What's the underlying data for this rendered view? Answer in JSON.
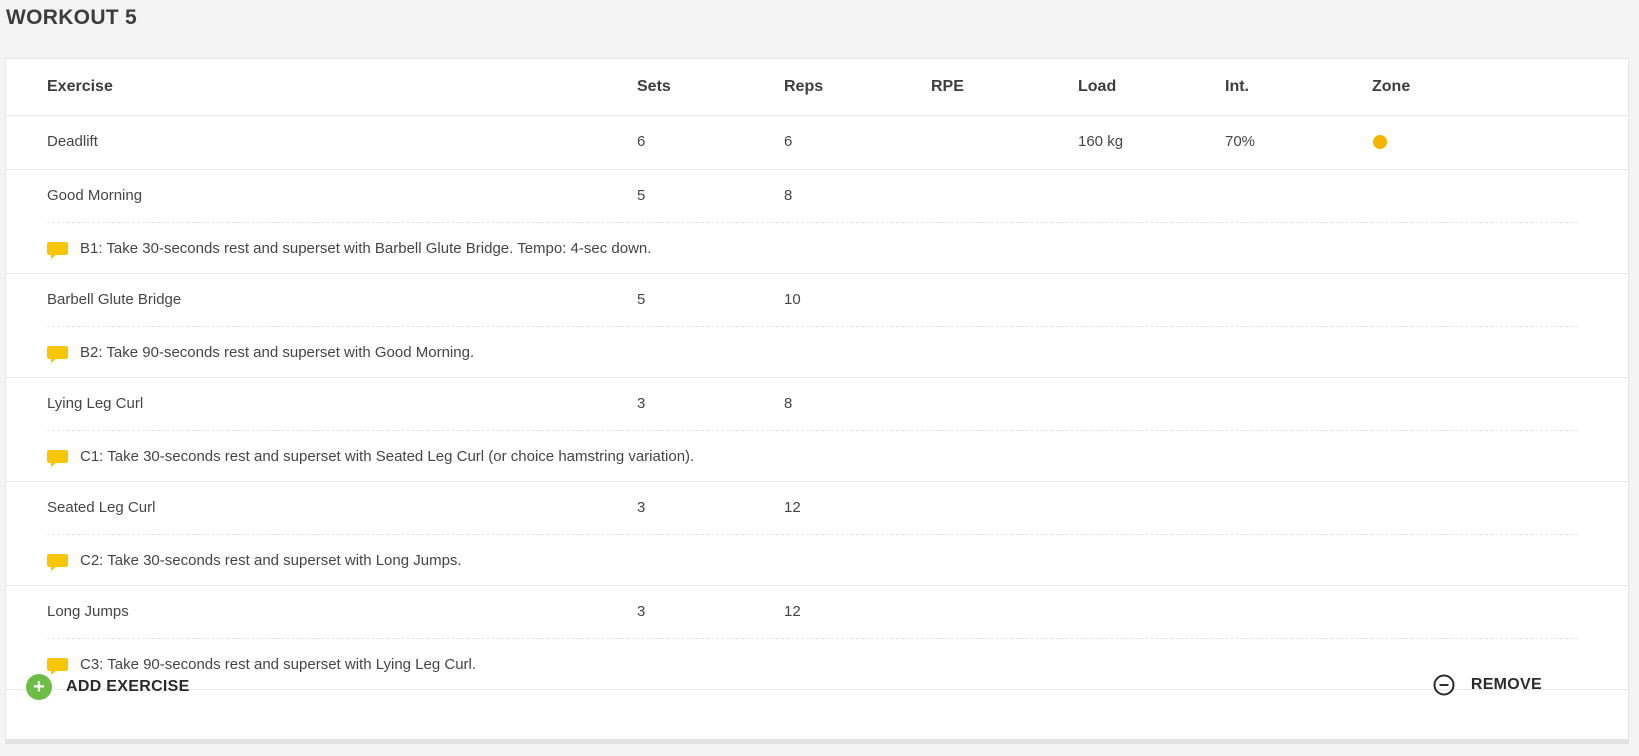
{
  "workout": {
    "title": "WORKOUT 5"
  },
  "colors": {
    "zone_dot": "#f5b400",
    "comment_icon": "#f7c600",
    "add_icon": "#6cbd45"
  },
  "table": {
    "headers": {
      "exercise": "Exercise",
      "sets": "Sets",
      "reps": "Reps",
      "rpe": "RPE",
      "load": "Load",
      "intensity": "Int.",
      "zone": "Zone"
    },
    "rows": [
      {
        "exercise": "Deadlift",
        "sets": "6",
        "reps": "6",
        "rpe": "",
        "load": "160 kg",
        "intensity": "70%",
        "zone_icon": "zone-dot"
      },
      {
        "exercise": "Good Morning",
        "sets": "5",
        "reps": "8",
        "note": "B1: Take 30-seconds rest and superset with Barbell Glute Bridge. Tempo: 4-sec down.",
        "note_icon": "comment-icon"
      },
      {
        "exercise": "Barbell Glute Bridge",
        "sets": "5",
        "reps": "10",
        "note": "B2: Take 90-seconds rest and superset with Good Morning.",
        "note_icon": "comment-icon"
      },
      {
        "exercise": "Lying Leg Curl",
        "sets": "3",
        "reps": "8",
        "note": "C1: Take 30-seconds rest and superset with Seated Leg Curl (or choice hamstring variation).",
        "note_icon": "comment-icon"
      },
      {
        "exercise": "Seated Leg Curl",
        "sets": "3",
        "reps": "12",
        "note": "C2: Take 30-seconds rest and superset with Long Jumps.",
        "note_icon": "comment-icon"
      },
      {
        "exercise": "Long Jumps",
        "sets": "3",
        "reps": "12",
        "note": "C3: Take 90-seconds rest and superset with Lying Leg Curl.",
        "note_icon": "comment-icon"
      }
    ]
  },
  "footer": {
    "add_label": "ADD EXERCISE",
    "add_icon": "plus-circle-icon",
    "remove_label": "REMOVE",
    "remove_icon": "minus-circle-icon"
  }
}
